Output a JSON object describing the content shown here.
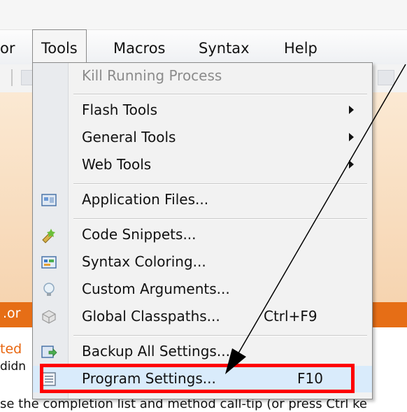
{
  "menubar": {
    "items": [
      {
        "label": "or"
      },
      {
        "label": "Tools"
      },
      {
        "label": "Macros"
      },
      {
        "label": "Syntax"
      },
      {
        "label": "Help"
      }
    ]
  },
  "tools_menu": {
    "items": [
      {
        "label": "Kill Running Process",
        "disabled": true
      },
      {
        "label": "Flash Tools",
        "submenu": true
      },
      {
        "label": "General Tools",
        "submenu": true
      },
      {
        "label": "Web Tools",
        "submenu": true
      },
      {
        "label": "Application Files...",
        "icon": "application-files-icon"
      },
      {
        "label": "Code Snippets...",
        "icon": "code-snippets-icon"
      },
      {
        "label": "Syntax Coloring...",
        "icon": "syntax-coloring-icon"
      },
      {
        "label": "Custom Arguments...",
        "icon": "lightbulb-icon"
      },
      {
        "label": "Global Classpaths...",
        "shortcut": "Ctrl+F9",
        "icon": "classpaths-icon"
      },
      {
        "label": "Backup All Settings...",
        "icon": "backup-icon"
      },
      {
        "label": "Program Settings...",
        "shortcut": "F10",
        "icon": "program-settings-icon",
        "highlighted": true
      }
    ]
  },
  "background": {
    "strip_text": ".or",
    "partial_text_1": "ted",
    "partial_text_2": "didn",
    "bottom_line": "se the completion list and method call-tip (or press Ctrl ke"
  },
  "annotation": {
    "highlight_color": "#ff0000",
    "arrow_color": "#000000"
  }
}
